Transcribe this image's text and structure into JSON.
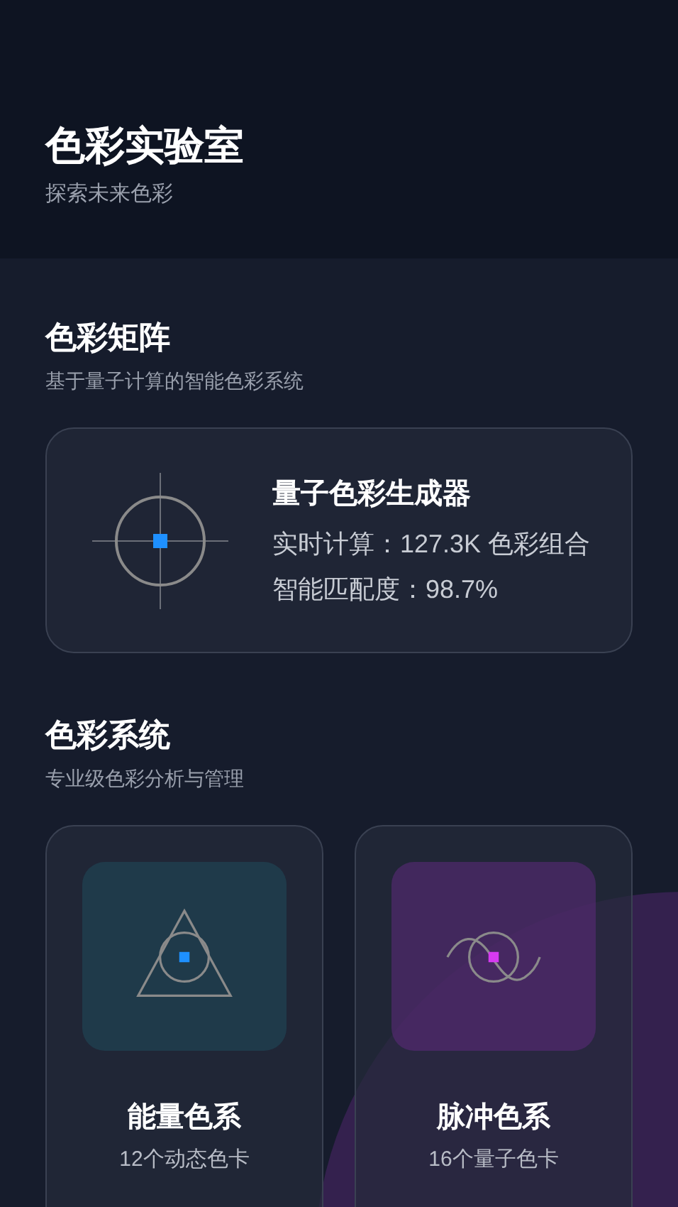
{
  "header": {
    "title": "色彩实验室",
    "subtitle": "探索未来色彩"
  },
  "matrix": {
    "title": "色彩矩阵",
    "subtitle": "基于量子计算的智能色彩系统",
    "card": {
      "title": "量子色彩生成器",
      "lines": [
        "实时计算：127.3K 色彩组合",
        "智能匹配度：98.7%"
      ]
    }
  },
  "systems": {
    "title": "色彩系统",
    "subtitle": "专业级色彩分析与管理",
    "cards": [
      {
        "kind": "triangle",
        "title": "能量色系",
        "caption": "12个动态色卡",
        "color": "#1e90ff"
      },
      {
        "kind": "wave",
        "title": "脉冲色系",
        "caption": "16个量子色卡",
        "color": "#d63af0"
      }
    ]
  }
}
